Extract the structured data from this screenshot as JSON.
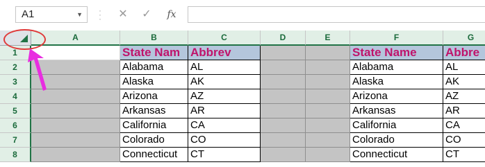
{
  "formula_bar": {
    "name_box": "A1",
    "cancel_icon": "✕",
    "enter_icon": "✓",
    "function_icon": "fx",
    "formula": ""
  },
  "columns": [
    "A",
    "B",
    "C",
    "D",
    "E",
    "F",
    "G"
  ],
  "rows": [
    "1",
    "2",
    "3",
    "4",
    "5",
    "6",
    "7",
    "8"
  ],
  "left_table": {
    "headers": [
      "State Nam",
      "Abbrev"
    ],
    "rows": [
      [
        "Alabama",
        "AL"
      ],
      [
        "Alaska",
        "AK"
      ],
      [
        "Arizona",
        "AZ"
      ],
      [
        "Arkansas",
        "AR"
      ],
      [
        "California",
        "CA"
      ],
      [
        "Colorado",
        "CO"
      ],
      [
        "Connecticut",
        "CT"
      ]
    ]
  },
  "right_table": {
    "headers": [
      "State Name",
      "Abbre"
    ],
    "rows": [
      [
        "Alabama",
        "AL"
      ],
      [
        "Alaska",
        "AK"
      ],
      [
        "Arizona",
        "AZ"
      ],
      [
        "Arkansas",
        "AR"
      ],
      [
        "California",
        "CA"
      ],
      [
        "Colorado",
        "CO"
      ],
      [
        "Connecticut",
        "CT"
      ]
    ]
  },
  "colors": {
    "excel_green": "#217346",
    "header_text": "#c0136b",
    "header_fill": "#b4c6dc",
    "gray_fill": "#c4c4c4",
    "annotation_circle": "#e03a3a",
    "annotation_arrow": "#e82ee0"
  }
}
